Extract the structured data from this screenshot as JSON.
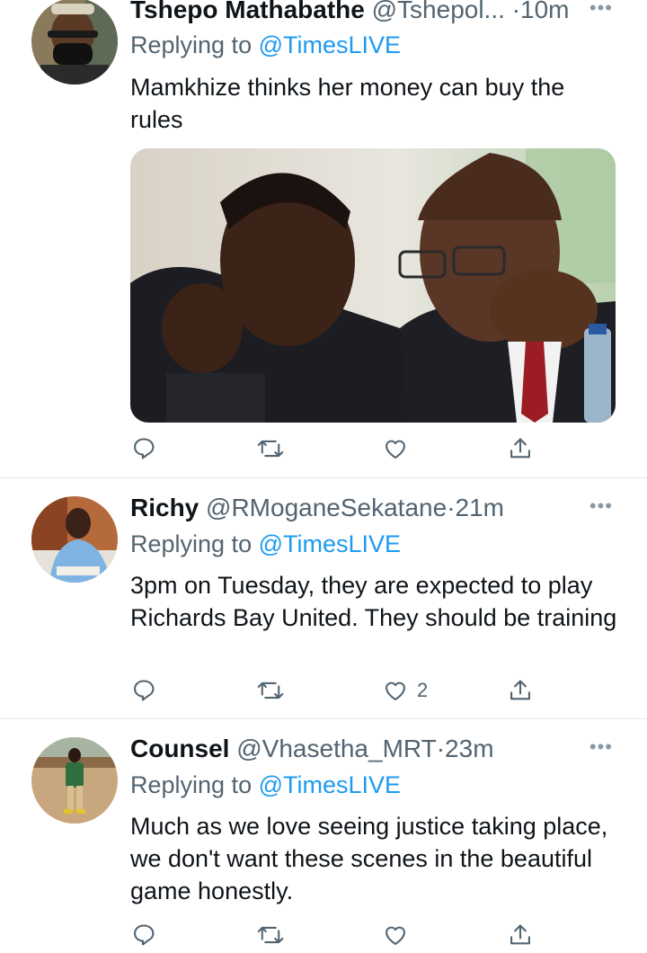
{
  "tweets": [
    {
      "name": "Tshepo Mathabathe",
      "handle": "@Tshepol...",
      "sep": "·",
      "time": "10m",
      "more": "•••",
      "replying_prefix": "Replying to ",
      "replying_handle": "@TimesLIVE",
      "text": "Mamkhize thinks her money can buy the rules",
      "like_count": ""
    },
    {
      "name": "Richy",
      "handle": "@RMoganeSekatane",
      "sep": "·",
      "time": "21m",
      "more": "•••",
      "replying_prefix": "Replying to ",
      "replying_handle": "@TimesLIVE",
      "text": "3pm on Tuesday, they are expected to play Richards Bay United. They should be training",
      "like_count": "2"
    },
    {
      "name": "Counsel",
      "handle": "@Vhasetha_MRT",
      "sep": "·",
      "time": "23m",
      "more": "•••",
      "replying_prefix": "Replying to ",
      "replying_handle": "@TimesLIVE",
      "text": "Much as we love seeing justice taking place, we don't want these scenes in the beautiful game honestly.",
      "like_count": ""
    }
  ],
  "icons": [
    "reply-icon",
    "retweet-icon",
    "like-icon",
    "share-icon",
    "more-icon"
  ],
  "colors": {
    "link": "#1d9bf0",
    "secondary": "#536471",
    "text": "#0f1419",
    "divider": "#e1e5e8"
  }
}
